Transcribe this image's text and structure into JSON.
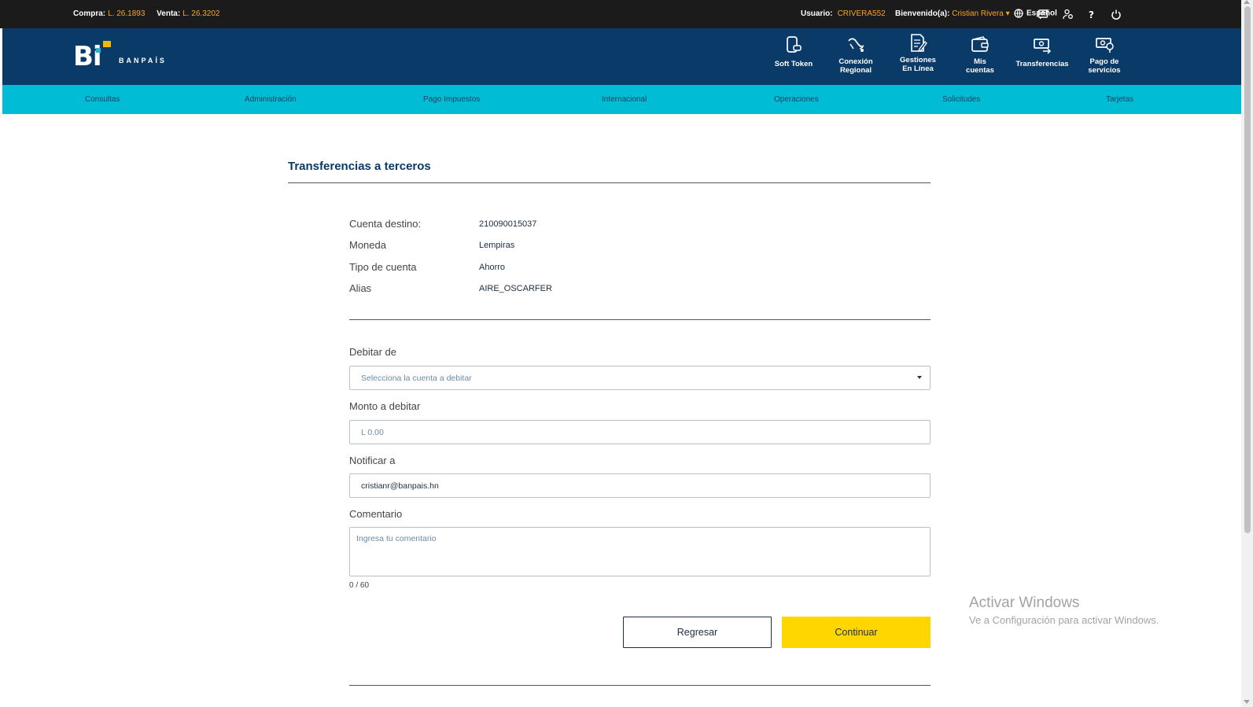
{
  "topbar": {
    "buy_label": "Compra:",
    "buy_value": "L. 26.1893",
    "sell_label": "Venta:",
    "sell_value": "L. 26.3202",
    "user_label": "Usuario:",
    "user_value": "CRIVERA552",
    "welcome_label": "Bienvenido(a):",
    "welcome_value": "Cristian Rivera ▾",
    "language": "Español",
    "accent_color": "#f5a623",
    "icons": [
      "globe-icon",
      "messages-icon",
      "user-settings-icon",
      "help-icon",
      "power-icon"
    ]
  },
  "header": {
    "logo_text": "Bi",
    "brand": "BANPAÍS",
    "nav": [
      {
        "label1": "Soft Token",
        "label2": "",
        "icon": "soft-token-icon"
      },
      {
        "label1": "Conexión",
        "label2": "Regional",
        "icon": "regional-connection-icon"
      },
      {
        "label1": "Gestiones",
        "label2": "En Línea",
        "icon": "online-requests-icon"
      },
      {
        "label1": "Mis",
        "label2": "cuentas",
        "icon": "wallet-icon"
      },
      {
        "label1": "Transferencias",
        "label2": "",
        "icon": "transfer-icon"
      },
      {
        "label1": "Pago de",
        "label2": "servicios",
        "icon": "service-payment-icon"
      }
    ]
  },
  "menu": {
    "items": [
      "Consultas",
      "Administración",
      "Pago Impuestos",
      "Internacional",
      "Operaciones",
      "Solicitudes",
      "Tarjetas"
    ]
  },
  "main": {
    "title": "Transferencias a terceros",
    "details": [
      {
        "label": "Cuenta destino:",
        "value": "210090015037"
      },
      {
        "label": "Moneda",
        "value": "Lempiras"
      },
      {
        "label": "Tipo de cuenta",
        "value": "Ahorro"
      },
      {
        "label": "Alias",
        "value": "AIRE_OSCARFER"
      }
    ],
    "debit": {
      "label": "Debitar de",
      "placeholder": "Selecciona la cuenta a debitar"
    },
    "amount": {
      "label": "Monto a debitar",
      "placeholder": "L 0.00"
    },
    "notify": {
      "label": "Notificar a",
      "value": "cristianr@banpais.hn"
    },
    "comment": {
      "label": "Comentario",
      "placeholder": "Ingresa tu comentario",
      "counter": "0 / 60"
    },
    "back_button": "Regresar",
    "continue_button": "Continuar"
  },
  "watermark": {
    "line1": "Activar Windows",
    "line2": "Ve a Configuración para activar Windows."
  },
  "colors": {
    "header_blue": "#0a3a68",
    "menu_cyan": "#00bcd4",
    "primary_yellow": "#ffd600"
  }
}
